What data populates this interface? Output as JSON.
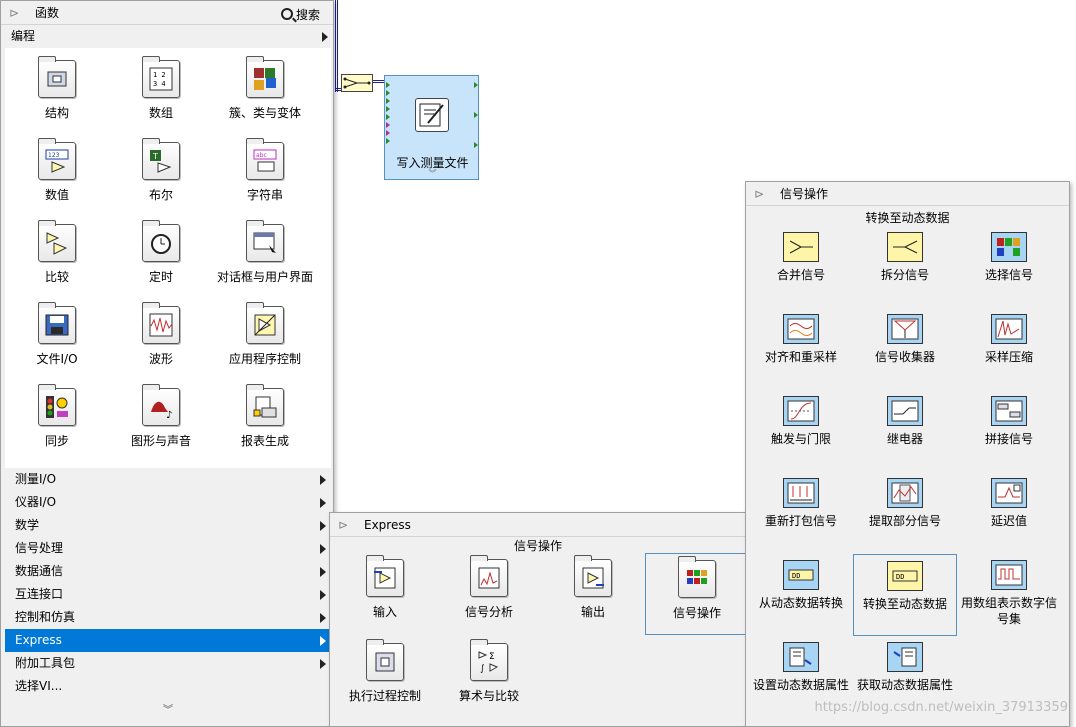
{
  "functions_palette": {
    "title": "函数",
    "search_label": "搜索",
    "open_category": "编程",
    "grid_items": [
      {
        "label": "结构",
        "icon": "structure-icon"
      },
      {
        "label": "数组",
        "icon": "array-icon"
      },
      {
        "label": "簇、类与变体",
        "icon": "cluster-icon"
      },
      {
        "label": "数值",
        "icon": "numeric-icon"
      },
      {
        "label": "布尔",
        "icon": "boolean-icon"
      },
      {
        "label": "字符串",
        "icon": "string-icon"
      },
      {
        "label": "比较",
        "icon": "comparison-icon"
      },
      {
        "label": "定时",
        "icon": "timing-icon"
      },
      {
        "label": "对话框与用户界面",
        "icon": "dialog-ui-icon"
      },
      {
        "label": "文件I/O",
        "icon": "file-io-icon"
      },
      {
        "label": "波形",
        "icon": "waveform-icon"
      },
      {
        "label": "应用程序控制",
        "icon": "app-control-icon"
      },
      {
        "label": "同步",
        "icon": "synchronization-icon"
      },
      {
        "label": "图形与声音",
        "icon": "graphics-sound-icon"
      },
      {
        "label": "报表生成",
        "icon": "report-generation-icon"
      }
    ],
    "categories": [
      {
        "label": "测量I/O",
        "selected": false
      },
      {
        "label": "仪器I/O",
        "selected": false
      },
      {
        "label": "数学",
        "selected": false
      },
      {
        "label": "信号处理",
        "selected": false
      },
      {
        "label": "数据通信",
        "selected": false
      },
      {
        "label": "互连接口",
        "selected": false
      },
      {
        "label": "控制和仿真",
        "selected": false
      },
      {
        "label": "Express",
        "selected": true
      },
      {
        "label": "附加工具包",
        "selected": false
      },
      {
        "label": "选择VI...",
        "selected": false
      }
    ],
    "more_chevron": "︾"
  },
  "diagram": {
    "node_label": "写入测量文件",
    "node_chevron": "︾"
  },
  "express_palette": {
    "title": "Express",
    "subtitle": "信号操作",
    "items": [
      {
        "label": "输入",
        "icon": "input-icon"
      },
      {
        "label": "信号分析",
        "icon": "signal-analysis-icon"
      },
      {
        "label": "输出",
        "icon": "output-icon"
      },
      {
        "label": "信号操作",
        "icon": "signal-manipulation-icon"
      },
      {
        "label": "执行过程控制",
        "icon": "exec-control-icon"
      },
      {
        "label": "算术与比较",
        "icon": "arith-compare-icon"
      }
    ]
  },
  "signal_palette": {
    "title": "信号操作",
    "subtitle": "转换至动态数据",
    "items": [
      {
        "label": "合并信号",
        "icon": "merge-signals-icon"
      },
      {
        "label": "拆分信号",
        "icon": "split-signals-icon"
      },
      {
        "label": "选择信号",
        "icon": "select-signals-icon"
      },
      {
        "label": "对齐和重采样",
        "icon": "align-resample-icon"
      },
      {
        "label": "信号收集器",
        "icon": "signal-collector-icon"
      },
      {
        "label": "采样压缩",
        "icon": "sample-compression-icon"
      },
      {
        "label": "触发与门限",
        "icon": "trigger-gate-icon"
      },
      {
        "label": "继电器",
        "icon": "relay-icon"
      },
      {
        "label": "拼接信号",
        "icon": "append-signals-icon"
      },
      {
        "label": "重新打包信号",
        "icon": "repack-signals-icon"
      },
      {
        "label": "提取部分信号",
        "icon": "extract-portion-icon"
      },
      {
        "label": "延迟值",
        "icon": "delay-values-icon"
      },
      {
        "label": "从动态数据转换",
        "icon": "from-dynamic-data-icon"
      },
      {
        "label": "转换至动态数据",
        "icon": "to-dynamic-data-icon"
      },
      {
        "label": "用数组表示数字信号集",
        "icon": "digital-array-icon"
      },
      {
        "label": "设置动态数据属性",
        "icon": "set-dd-attributes-icon"
      },
      {
        "label": "获取动态数据属性",
        "icon": "get-dd-attributes-icon"
      }
    ]
  },
  "watermark": "https://blog.csdn.net/weixin_37913359"
}
